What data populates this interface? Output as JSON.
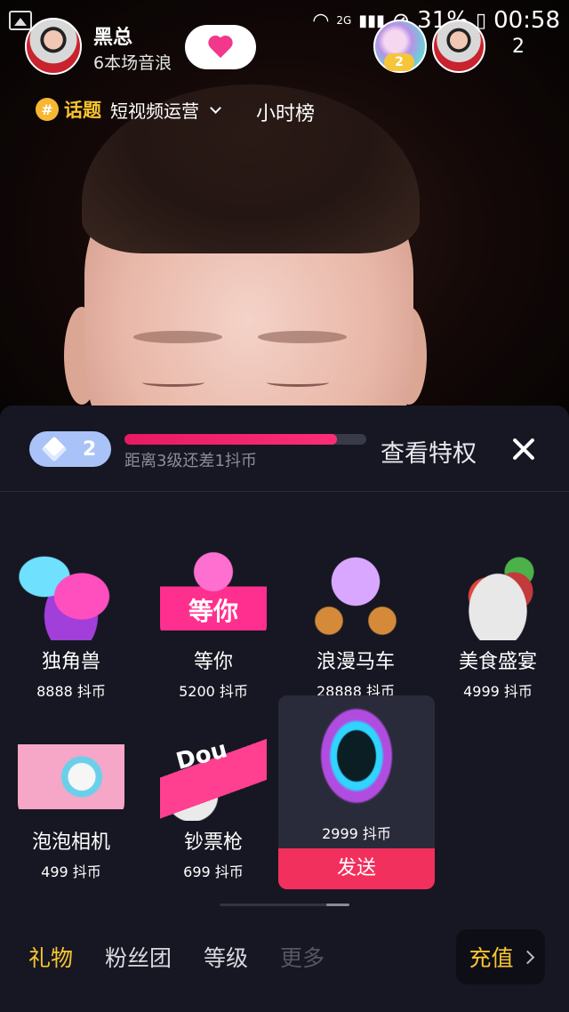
{
  "status_bar": {
    "battery": "31%",
    "time": "00:58",
    "network": "2G"
  },
  "host": {
    "name": "黑总",
    "sub": "6本场音浪"
  },
  "viewers": {
    "rank_badge": "2",
    "count": "2"
  },
  "topic": {
    "icon": "#",
    "label": "话题",
    "name": "短视频运营"
  },
  "hour_rank": "小时榜",
  "level": {
    "current": "2",
    "progress": 0.88,
    "progress_text": "距离3级还差1抖币",
    "privilege": "查看特权"
  },
  "gifts": [
    {
      "name": "独角兽",
      "price": "8888 抖币",
      "icon": "unicorn-icon"
    },
    {
      "name": "等你",
      "price": "5200 抖币",
      "icon": "wait-for-you-icon",
      "art_text": "等你"
    },
    {
      "name": "浪漫马车",
      "price": "28888 抖币",
      "icon": "carriage-icon"
    },
    {
      "name": "美食盛宴",
      "price": "4999 抖币",
      "icon": "feast-icon"
    },
    {
      "name": "泡泡相机",
      "price": "499 抖币",
      "icon": "camera-icon"
    },
    {
      "name": "钞票枪",
      "price": "699 抖币",
      "icon": "money-gun-icon",
      "art_text": "Dou"
    }
  ],
  "selected_gift": {
    "price": "2999 抖币",
    "send": "发送",
    "icon": "portal-icon"
  },
  "tabs": [
    "礼物",
    "粉丝团",
    "等级",
    "更多"
  ],
  "recharge": "充值",
  "colors": {
    "accent_yellow": "#fbc531",
    "send_red": "#f2305d",
    "panel_bg": "#161722",
    "progress_pink": "#fb2d77"
  }
}
